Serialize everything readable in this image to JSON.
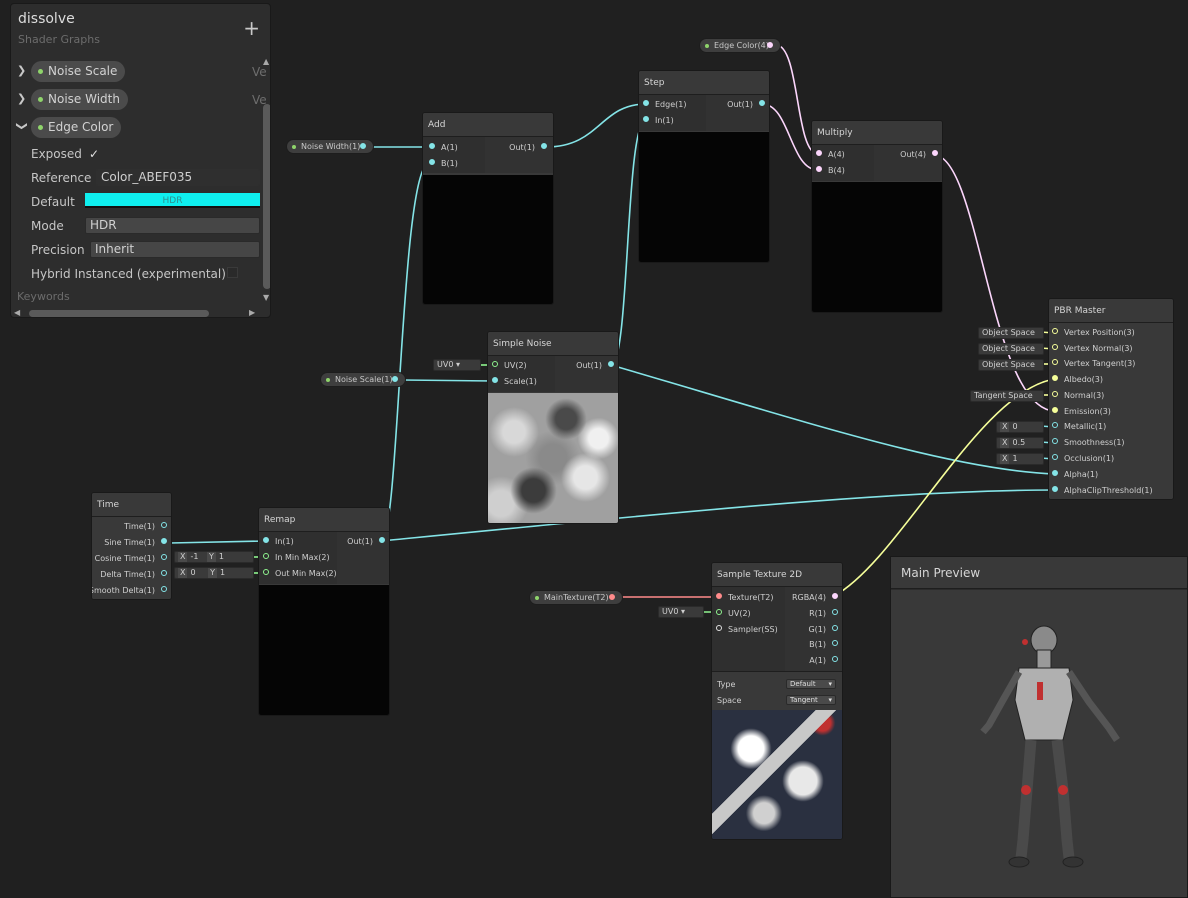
{
  "blackboard": {
    "title": "dissolve",
    "subtitle": "Shader Graphs",
    "add_label": "+",
    "properties": [
      {
        "name": "Noise Scale",
        "type_hint": "Ve",
        "expanded": false
      },
      {
        "name": "Noise Width",
        "type_hint": "Ve",
        "expanded": false
      },
      {
        "name": "Edge Color",
        "expanded": true
      }
    ],
    "edge_color": {
      "exposed_label": "Exposed",
      "exposed_value": "✓",
      "reference_label": "Reference",
      "reference_value": "Color_ABEF035",
      "default_label": "Default",
      "default_hint": "HDR",
      "default_color": "#0fefef",
      "mode_label": "Mode",
      "mode_value": "HDR",
      "precision_label": "Precision",
      "precision_value": "Inherit",
      "hybrid_label": "Hybrid Instanced (experimental)"
    },
    "keywords_label": "Keywords"
  },
  "nodes": {
    "add": {
      "title": "Add",
      "in_a": "A(1)",
      "in_b": "B(1)",
      "out": "Out(1)"
    },
    "step": {
      "title": "Step",
      "in_edge": "Edge(1)",
      "in_in": "In(1)",
      "out": "Out(1)"
    },
    "multiply": {
      "title": "Multiply",
      "in_a": "A(4)",
      "in_b": "B(4)",
      "out": "Out(4)"
    },
    "simple_noise": {
      "title": "Simple Noise",
      "in_uv": "UV(2)",
      "in_scale": "Scale(1)",
      "out": "Out(1)",
      "uv_default": "UV0"
    },
    "time": {
      "title": "Time",
      "outs": [
        "Time(1)",
        "Sine Time(1)",
        "Cosine Time(1)",
        "Delta Time(1)",
        "Smooth Delta(1)"
      ]
    },
    "remap": {
      "title": "Remap",
      "in_in": "In(1)",
      "in_min_max": "In Min Max(2)",
      "out_min_max": "Out Min Max(2)",
      "out": "Out(1)",
      "in_min_max_x": "-1",
      "in_min_max_y": "1",
      "out_min_max_x": "0",
      "out_min_max_y": "1"
    },
    "sample_texture": {
      "title": "Sample Texture 2D",
      "ins": [
        "Texture(T2)",
        "UV(2)",
        "Sampler(SS)"
      ],
      "outs": [
        "RGBA(4)",
        "R(1)",
        "G(1)",
        "B(1)",
        "A(1)"
      ],
      "uv_default": "UV0",
      "type_label": "Type",
      "type_value": "Default",
      "space_label": "Space",
      "space_value": "Tangent"
    },
    "pbr_master": {
      "title": "PBR Master",
      "inputs": [
        "Vertex Position(3)",
        "Vertex Normal(3)",
        "Vertex Tangent(3)",
        "Albedo(3)",
        "Normal(3)",
        "Emission(3)",
        "Metallic(1)",
        "Smoothness(1)",
        "Occlusion(1)",
        "Alpha(1)",
        "AlphaClipThreshold(1)"
      ],
      "space_defaults": [
        "Object Space",
        "Object Space",
        "Object Space",
        "Tangent Space"
      ],
      "metallic_value": "0",
      "smoothness_value": "0.5",
      "occlusion_value": "1"
    }
  },
  "property_nodes": {
    "noise_width": "Noise Width(1)",
    "noise_scale": "Noise Scale(1)",
    "edge_color": "Edge Color(4)",
    "main_texture": "MainTexture(T2)"
  },
  "x_label": "X",
  "y_label": "Y",
  "main_preview": {
    "title": "Main Preview"
  },
  "colors": {
    "float_wire": "#84e4e7",
    "vector4_wire": "#fcd6fc",
    "vector3_wire": "#f6ff9a",
    "texture_wire": "#ff8b8b"
  }
}
